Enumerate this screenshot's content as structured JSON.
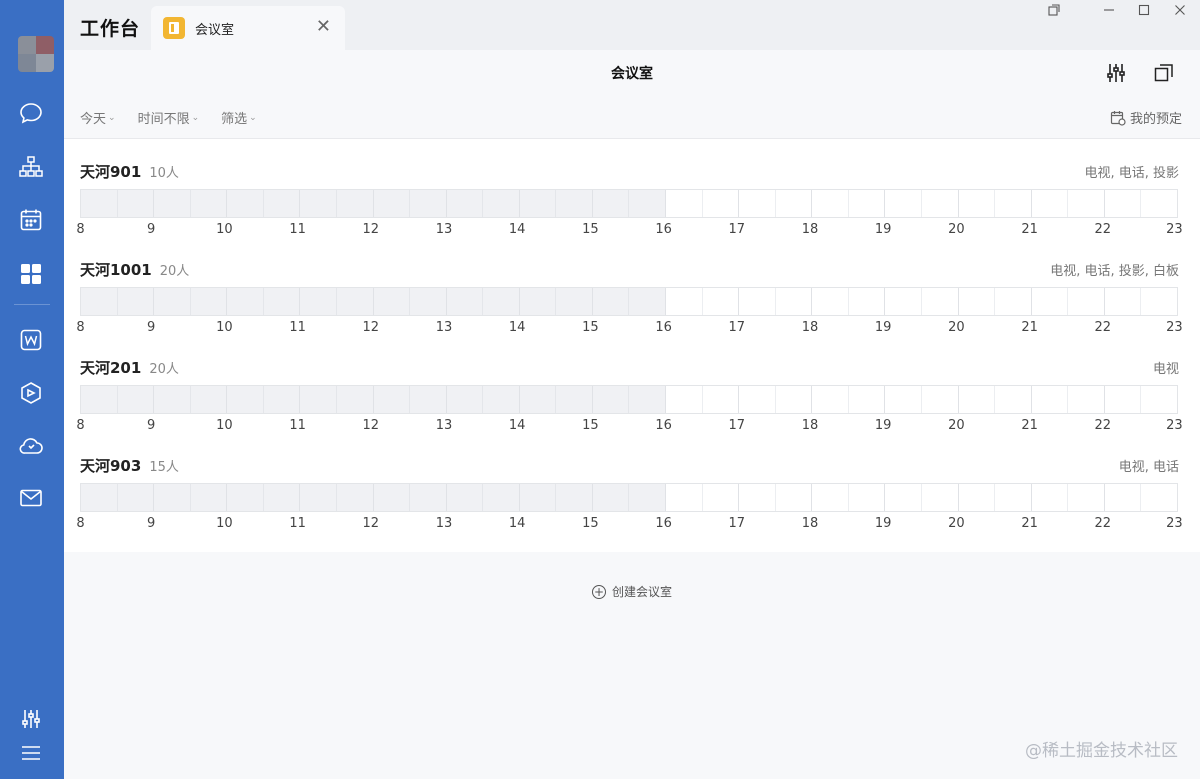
{
  "app": {
    "title": "工作台"
  },
  "tab": {
    "label": "会议室",
    "icon": "meeting-room-app-icon",
    "icon_color": "#f2b632"
  },
  "sidebar": {
    "color": "#3a6fc4",
    "items": [
      {
        "name": "chat",
        "icon": "chat-bubble-icon"
      },
      {
        "name": "org",
        "icon": "org-chart-icon"
      },
      {
        "name": "calendar",
        "icon": "calendar-icon"
      },
      {
        "name": "workbench",
        "icon": "grid-apps-icon",
        "active": true
      },
      {
        "name": "docs",
        "icon": "word-doc-icon"
      },
      {
        "name": "box",
        "icon": "cube-icon"
      },
      {
        "name": "cloud",
        "icon": "cloud-icon"
      },
      {
        "name": "mail",
        "icon": "mail-icon"
      }
    ],
    "bottom": [
      {
        "name": "settings",
        "icon": "sliders-icon"
      },
      {
        "name": "menu",
        "icon": "hamburger-menu-icon"
      }
    ]
  },
  "header": {
    "title": "会议室"
  },
  "filters": [
    {
      "label": "今天"
    },
    {
      "label": "时间不限"
    },
    {
      "label": "筛选"
    }
  ],
  "my_booking": {
    "label": "我的预定"
  },
  "hours": [
    "8",
    "9",
    "10",
    "11",
    "12",
    "13",
    "14",
    "15",
    "16",
    "17",
    "18",
    "19",
    "20",
    "21",
    "22",
    "23"
  ],
  "past_until_hour": 16,
  "rooms": [
    {
      "name": "天河901",
      "capacity": "10人",
      "equipment": "电视, 电话, 投影"
    },
    {
      "name": "天河1001",
      "capacity": "20人",
      "equipment": "电视, 电话, 投影, 白板"
    },
    {
      "name": "天河201",
      "capacity": "20人",
      "equipment": "电视"
    },
    {
      "name": "天河903",
      "capacity": "15人",
      "equipment": "电视, 电话"
    }
  ],
  "create_room": {
    "label": "创建会议室"
  },
  "watermark": "@稀土掘金技术社区"
}
